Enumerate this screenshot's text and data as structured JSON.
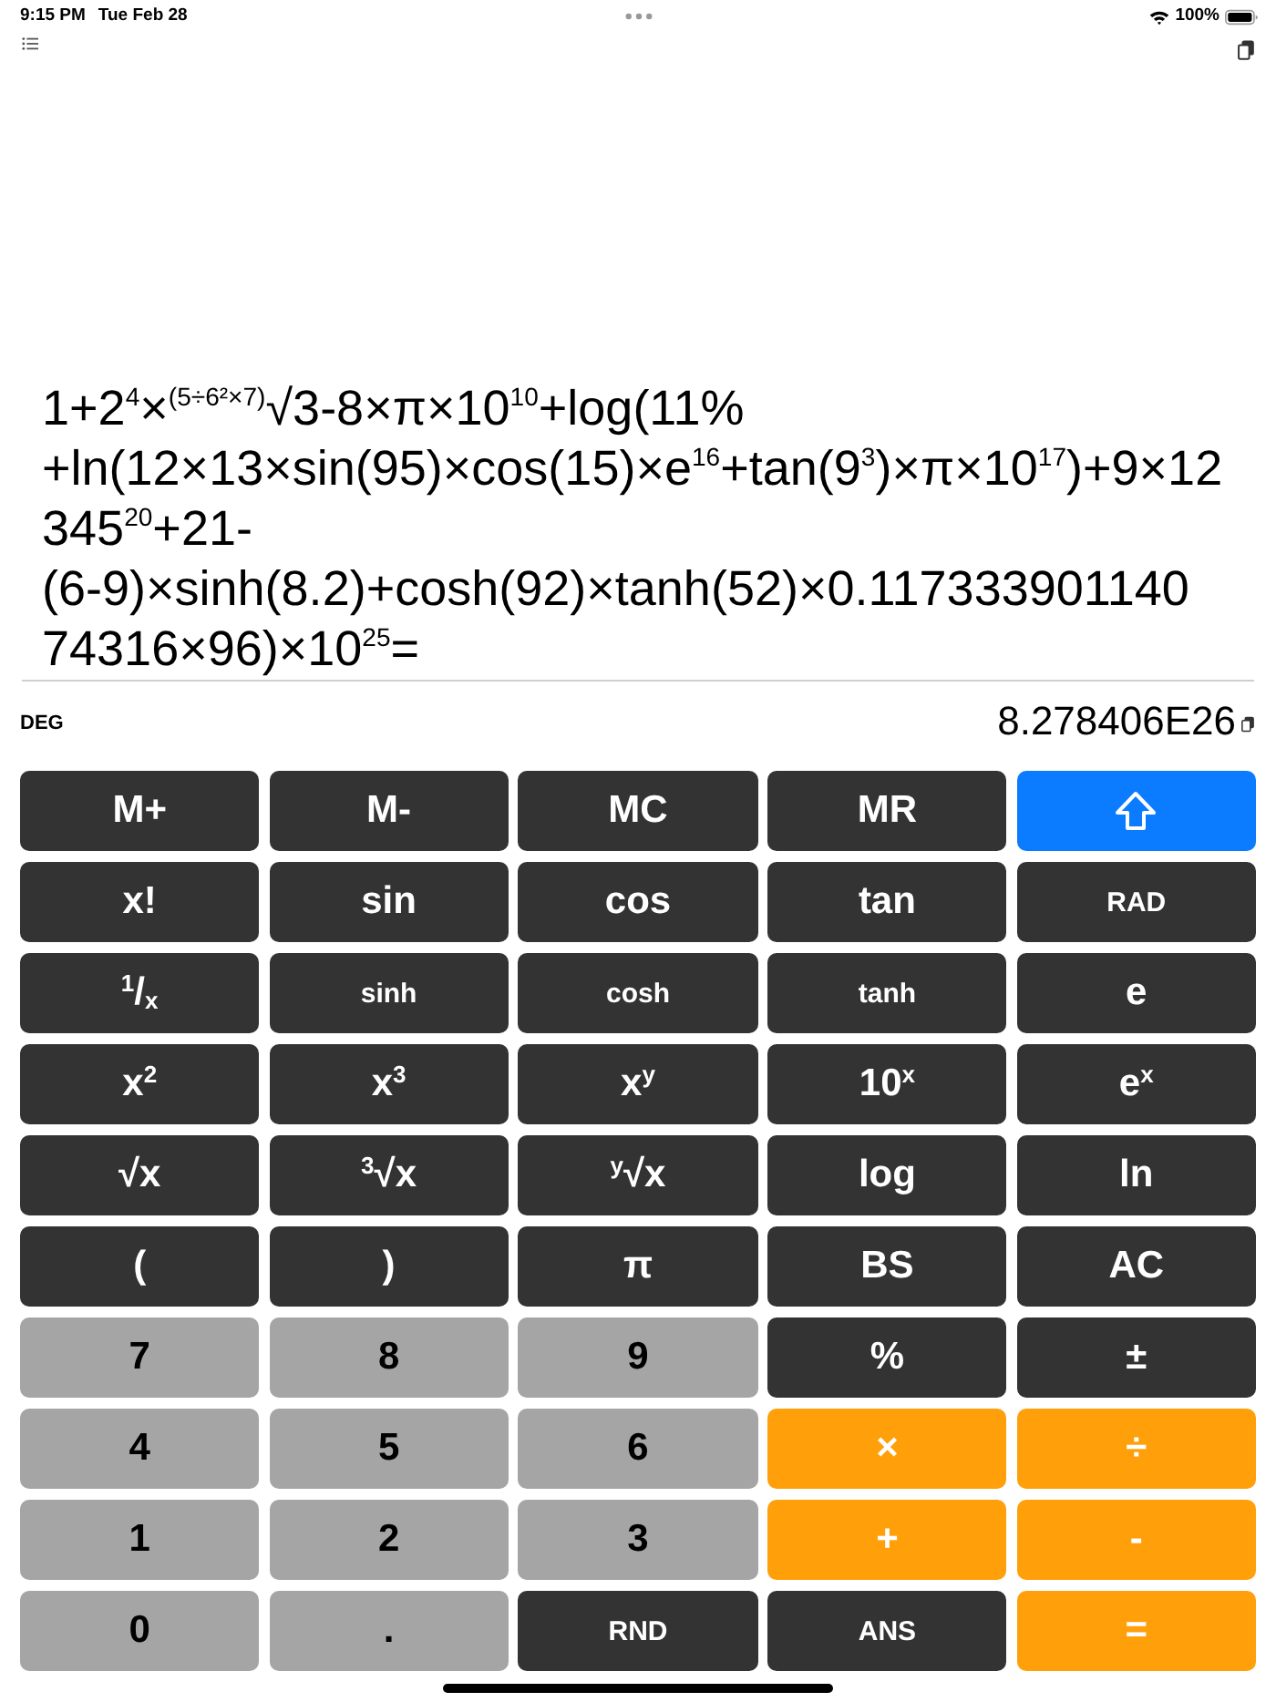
{
  "status_bar": {
    "time": "9:15 PM",
    "date": "Tue Feb 28",
    "battery": "100%"
  },
  "expression": {
    "lines": [
      "1+2$^{4}$×$^{(5÷6²×7)}$√3-8×π×10$^{10}$+log(11%",
      "+ln(12×13×sin(95)×cos(15)×e$^{16}$+tan(9$^{3}$)×π×10$^{17}$)+9×12",
      "345$^{20}$+21-",
      "(6-9)×sinh(8.2)+cosh(92)×tanh(52)×0.117333901140",
      "74316×96)×10$^{25}$="
    ]
  },
  "display": {
    "angle_mode": "DEG",
    "result": "8.278406E26"
  },
  "keypad": [
    {
      "label": "M+",
      "kind": "function"
    },
    {
      "label": "M-",
      "kind": "function"
    },
    {
      "label": "MC",
      "kind": "function"
    },
    {
      "label": "MR",
      "kind": "function"
    },
    {
      "kind": "shift"
    },
    {
      "label": "x!",
      "kind": "function"
    },
    {
      "label": "sin",
      "kind": "function"
    },
    {
      "label": "cos",
      "kind": "function"
    },
    {
      "label": "tan",
      "kind": "function"
    },
    {
      "label": "RAD",
      "kind": "label"
    },
    {
      "label": "$^{1}$/$_{x}$",
      "kind": "function"
    },
    {
      "label": "sinh",
      "kind": "label"
    },
    {
      "label": "cosh",
      "kind": "label"
    },
    {
      "label": "tanh",
      "kind": "label"
    },
    {
      "label": "e",
      "kind": "function"
    },
    {
      "label": "x$^{2}$",
      "kind": "function"
    },
    {
      "label": "x$^{3}$",
      "kind": "function"
    },
    {
      "label": "x$^{y}$",
      "kind": "function"
    },
    {
      "label": "10$^{x}$",
      "kind": "function"
    },
    {
      "label": "e$^{x}$",
      "kind": "function"
    },
    {
      "label": "√x",
      "kind": "function"
    },
    {
      "label": "$^{3}$√x",
      "kind": "function"
    },
    {
      "label": "$^{y}$√x",
      "kind": "function"
    },
    {
      "label": "log",
      "kind": "function"
    },
    {
      "label": "ln",
      "kind": "function"
    },
    {
      "label": "(",
      "kind": "function"
    },
    {
      "label": ")",
      "kind": "function"
    },
    {
      "label": "π",
      "kind": "function"
    },
    {
      "label": "BS",
      "kind": "function"
    },
    {
      "label": "AC",
      "kind": "function"
    },
    {
      "label": "7",
      "kind": "digit"
    },
    {
      "label": "8",
      "kind": "digit"
    },
    {
      "label": "9",
      "kind": "digit"
    },
    {
      "label": "%",
      "kind": "function"
    },
    {
      "label": "±",
      "kind": "function"
    },
    {
      "label": "4",
      "kind": "digit"
    },
    {
      "label": "5",
      "kind": "digit"
    },
    {
      "label": "6",
      "kind": "digit"
    },
    {
      "label": "×",
      "kind": "operator"
    },
    {
      "label": "÷",
      "kind": "operator"
    },
    {
      "label": "1",
      "kind": "digit"
    },
    {
      "label": "2",
      "kind": "digit"
    },
    {
      "label": "3",
      "kind": "digit"
    },
    {
      "label": "+",
      "kind": "operator"
    },
    {
      "label": "-",
      "kind": "operator"
    },
    {
      "label": "0",
      "kind": "digit"
    },
    {
      "label": ".",
      "kind": "digit"
    },
    {
      "label": "RND",
      "kind": "label"
    },
    {
      "label": "ANS",
      "kind": "label"
    },
    {
      "label": "=",
      "kind": "operator"
    }
  ]
}
